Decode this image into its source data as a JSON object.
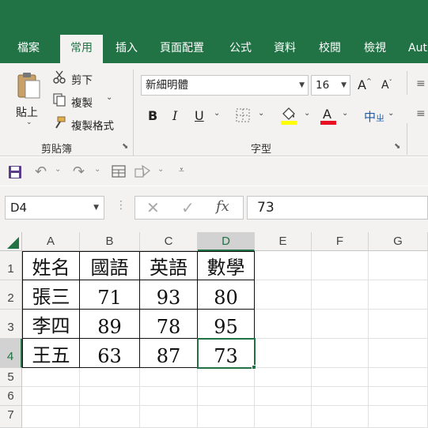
{
  "ribbon_tabs": [
    "檔案",
    "常用",
    "插入",
    "頁面配置",
    "公式",
    "資料",
    "校閱",
    "檢視",
    "Aut"
  ],
  "active_tab": "常用",
  "clipboard": {
    "paste_label": "貼上",
    "cut_label": "剪下",
    "copy_label": "複製",
    "format_painter_label": "複製格式",
    "group_label": "剪貼簿"
  },
  "font": {
    "name": "新細明體",
    "size": "16",
    "group_label": "字型",
    "bold": "B",
    "italic": "I",
    "underline": "U",
    "grow": "A",
    "shrink": "A",
    "phonetic": "中",
    "fill_color": "#ffff00",
    "font_color": "#e81123"
  },
  "formula_bar": {
    "name_box": "D4",
    "fx_label": "fx",
    "value": "73"
  },
  "columns": [
    "A",
    "B",
    "C",
    "D",
    "E",
    "F",
    "G"
  ],
  "selected_column": "D",
  "rows": [
    "1",
    "2",
    "3",
    "4",
    "5",
    "6",
    "7"
  ],
  "selected_row": "4",
  "table": [
    [
      "姓名",
      "國語",
      "英語",
      "數學"
    ],
    [
      "張三",
      "71",
      "93",
      "80"
    ],
    [
      "李四",
      "89",
      "78",
      "95"
    ],
    [
      "王五",
      "63",
      "87",
      "73"
    ]
  ],
  "selected_cell": "D4",
  "accent_color": "#217346"
}
